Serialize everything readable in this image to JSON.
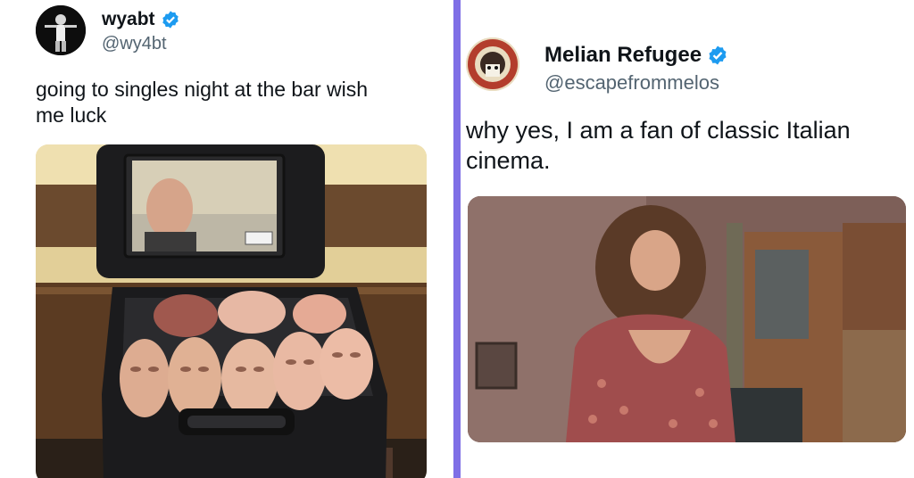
{
  "colors": {
    "divider": "#7f6fe6",
    "verified": "#1d9bf0",
    "handle": "#536471"
  },
  "left_tweet": {
    "display_name": "wyabt",
    "handle": "@wy4bt",
    "text_line1": "going to singles night at the bar wish",
    "text_line2": "me luck",
    "verified_icon": "verified-badge-icon",
    "media_desc_icon": "suitcase-of-masks-photo"
  },
  "right_tweet": {
    "display_name": "Melian Refugee",
    "handle": "@escapefrommelos",
    "text_line1": "why yes, I am a fan of classic Italian",
    "text_line2": "cinema.",
    "verified_icon": "verified-badge-icon",
    "media_desc_icon": "film-still-photo"
  }
}
